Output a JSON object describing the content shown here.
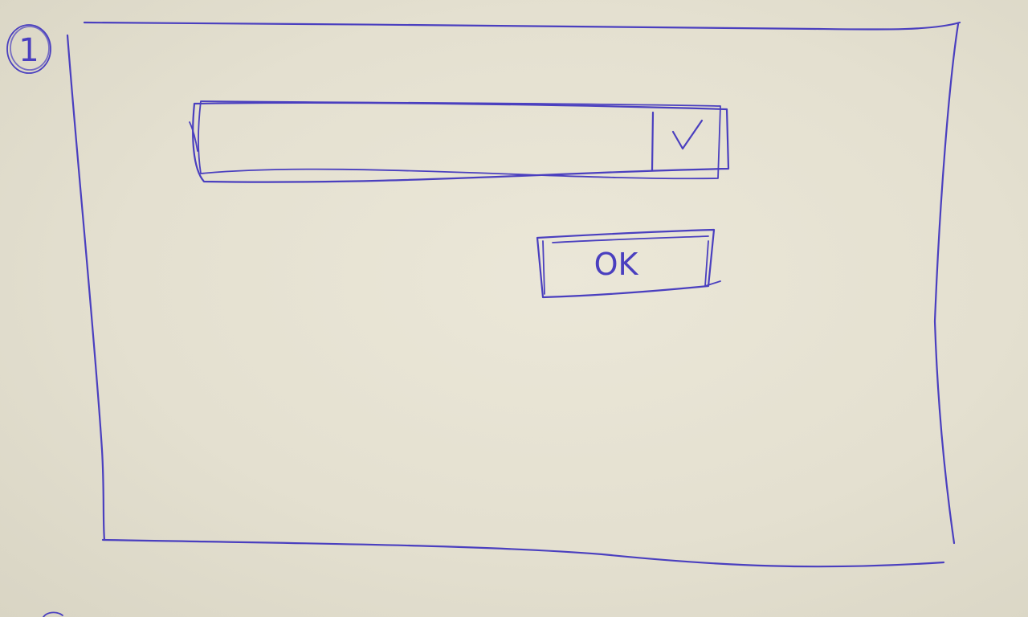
{
  "screen": {
    "number_label": "1"
  },
  "dialog": {
    "dropdown": {
      "selected_value": "",
      "chevron_icon": "chevron-down-icon"
    },
    "ok_button": {
      "label": "OK"
    }
  },
  "colors": {
    "ink": "#4a3fbf",
    "paper": "#e7e3d4"
  }
}
